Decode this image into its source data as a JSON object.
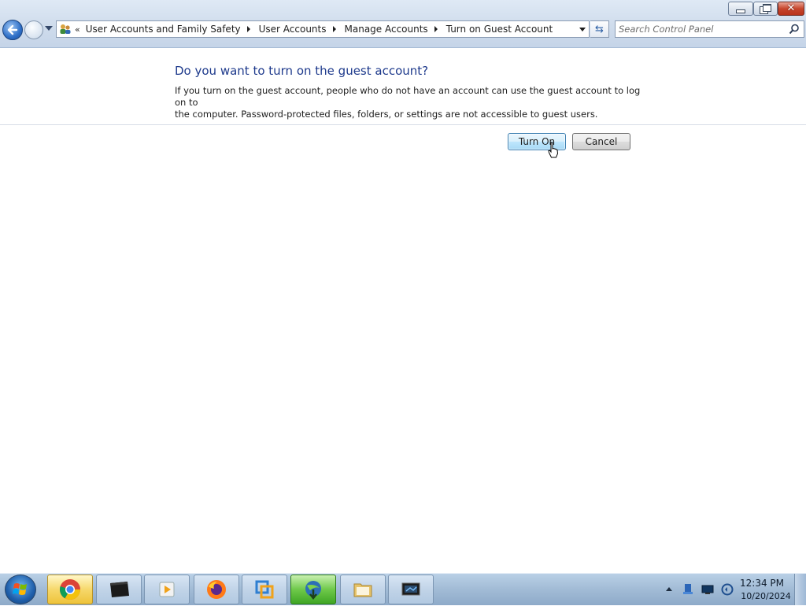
{
  "window": {
    "minimize_icon": "minimize-icon",
    "maximize_icon": "restore-icon",
    "close_icon": "close-icon"
  },
  "nav": {
    "breadcrumbs": [
      "User Accounts and Family Safety",
      "User Accounts",
      "Manage Accounts",
      "Turn on Guest Account"
    ],
    "overflow_chevron": "«",
    "search_placeholder": "Search Control Panel"
  },
  "content": {
    "title": "Do you want to turn on the guest account?",
    "description_line1": "If you turn on the guest account, people who do not have an account can use the guest account to log on to",
    "description_line2": "the computer. Password-protected files, folders, or settings are not accessible to guest users.",
    "primary_button": "Turn On",
    "secondary_button": "Cancel"
  },
  "taskbar": {
    "apps": [
      "chrome",
      "terminal",
      "media-player",
      "firefox",
      "vmware",
      "idm",
      "explorer",
      "control-panel"
    ],
    "clock_time": "12:34 PM",
    "clock_date": "10/20/2024"
  },
  "colors": {
    "title": "#1e3a8c",
    "accent_button": "#bee6fd"
  }
}
